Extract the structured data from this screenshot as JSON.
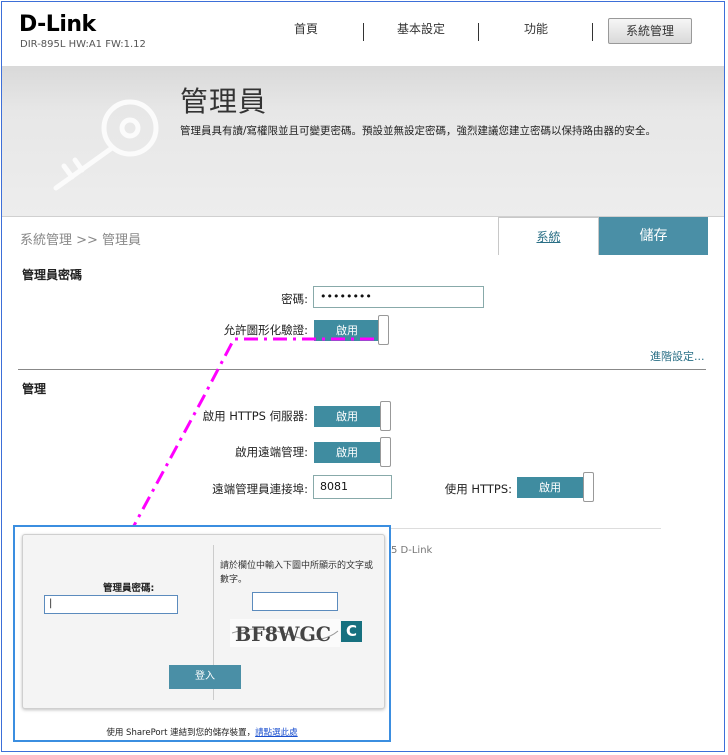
{
  "header": {
    "logo": "D-Link",
    "model": "DIR-895L HW:A1 FW:1.12",
    "nav": [
      "首頁",
      "基本設定",
      "功能",
      "系統管理"
    ]
  },
  "banner": {
    "title": "管理員",
    "description": "管理員具有讀/寫權限並且可變更密碼。預設並無設定密碼，強烈建議您建立密碼以保持路由器的安全。"
  },
  "breadcrumb": "系統管理 >> 管理員",
  "actions": {
    "system_link": "系統",
    "save": "儲存"
  },
  "admin_password": {
    "section_title": "管理員密碼",
    "password_label": "密碼:",
    "password_value": "••••••••",
    "captcha_label": "允許圖形化驗證:",
    "captcha_toggle": "啟用",
    "advanced_link": "進階設定..."
  },
  "management": {
    "section_title": "管理",
    "https_server_label": "啟用 HTTPS 伺服器:",
    "https_server_toggle": "啟用",
    "remote_mgmt_label": "啟用遠端管理:",
    "remote_mgmt_toggle": "啟用",
    "remote_port_label": "遠端管理員連接埠:",
    "remote_port_value": "8081",
    "use_https_label": "使用 HTTPS:",
    "use_https_toggle": "啟用"
  },
  "copyright_fragment": "5 D-Link",
  "login_popup": {
    "password_label": "管理員密碼:",
    "password_value": "|",
    "captcha_instruction": "請於欄位中輸入下圖中所顯示的文字或數字。",
    "captcha_text": "BF8WGC",
    "refresh_icon": "C",
    "login_button": "登入",
    "footer_text": "使用 SharePort 連結到您的儲存裝置，",
    "footer_link": "請點選此處"
  },
  "colors": {
    "accent": "#4a8fa6",
    "toggle": "#3f8ca0",
    "annotation_arrow": "#ff00ff",
    "popup_border": "#3b8ee0"
  }
}
